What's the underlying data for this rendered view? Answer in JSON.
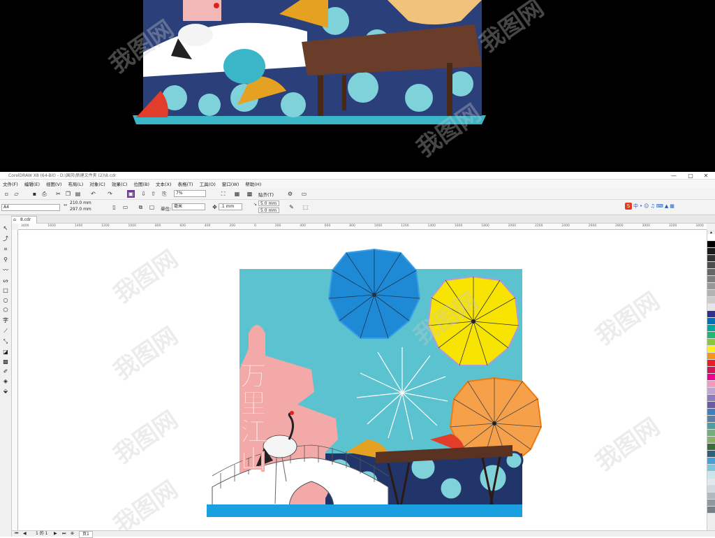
{
  "app": {
    "title": "CorelDRAW X8 (64-Bit) - D:\\国风\\新建文件夹 (2)\\8.cdr",
    "window_buttons": [
      "—",
      "□",
      "✕"
    ]
  },
  "menu": [
    "文件(F)",
    "编辑(E)",
    "视图(V)",
    "布局(L)",
    "对象(C)",
    "效果(C)",
    "位图(B)",
    "文本(X)",
    "表格(T)",
    "工具(O)",
    "窗口(W)",
    "帮助(H)"
  ],
  "toolbar": {
    "zoom": "7%",
    "snap_label": "贴齐(T)"
  },
  "property_bar": {
    "page_size": "A4",
    "width": "210.0 mm",
    "height": "297.0 mm",
    "units_label": "单位:",
    "units_value": "毫米",
    "nudge": ".1 mm",
    "dup_x": "5.0 mm",
    "dup_y": "5.0 mm"
  },
  "ime": {
    "label": "中"
  },
  "doc_tab": {
    "name": "8.cdr"
  },
  "ruler_ticks": [
    "3400",
    "1600",
    "1400",
    "1200",
    "1000",
    "800",
    "600",
    "400",
    "200",
    "0",
    "200",
    "400",
    "600",
    "800",
    "1000",
    "1200",
    "1400",
    "1600",
    "1800",
    "2000",
    "2200",
    "2400",
    "2600",
    "2800",
    "3000",
    "3200",
    "3400"
  ],
  "artwork": {
    "vertical_text": [
      "万",
      "里",
      "江",
      "山"
    ]
  },
  "status": {
    "page_info": "1 的 1",
    "page_tab": "页1"
  },
  "watermark": "我图网",
  "colors": {
    "sky": "#5bc3cf",
    "pagoda": "#f2a9a7",
    "umbrella_blue": "#1e8ad6",
    "umbrella_yellow": "#f7e400",
    "umbrella_orange": "#f7a04a",
    "base_blue": "#1aa0e0",
    "wave_navy": "#22356b"
  }
}
